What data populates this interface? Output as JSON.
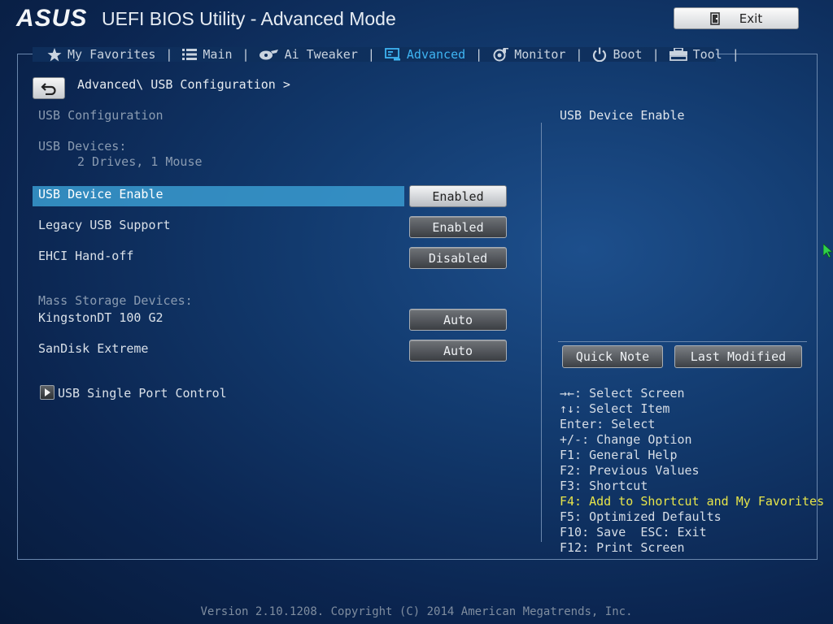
{
  "header": {
    "logo_text": "ASUS",
    "title": "UEFI BIOS Utility - Advanced Mode",
    "exit_label": "Exit"
  },
  "tabs": [
    {
      "label": "My Favorites",
      "icon": "star-icon",
      "active": false
    },
    {
      "label": "Main",
      "icon": "list-icon",
      "active": false
    },
    {
      "label": "Ai Tweaker",
      "icon": "tweaker-icon",
      "active": false
    },
    {
      "label": "Advanced",
      "icon": "advanced-icon",
      "active": true
    },
    {
      "label": "Monitor",
      "icon": "monitor-icon",
      "active": false
    },
    {
      "label": "Boot",
      "icon": "power-icon",
      "active": false
    },
    {
      "label": "Tool",
      "icon": "tool-icon",
      "active": false
    }
  ],
  "breadcrumb": "Advanced\\ USB Configuration >",
  "main": {
    "section_title": "USB Configuration",
    "usb_devices_label": "USB Devices:",
    "usb_devices_value": "2 Drives, 1 Mouse",
    "settings": [
      {
        "label": "USB Device Enable",
        "value": "Enabled",
        "selected": true
      },
      {
        "label": "Legacy USB Support",
        "value": "Enabled",
        "selected": false
      },
      {
        "label": "EHCI Hand-off",
        "value": "Disabled",
        "selected": false
      }
    ],
    "mass_storage_label": "Mass Storage Devices:",
    "mass_storage": [
      {
        "label": "KingstonDT 100 G2",
        "value": "Auto"
      },
      {
        "label": "SanDisk Extreme",
        "value": "Auto"
      }
    ],
    "submenu": "USB Single Port Control"
  },
  "right_panel": {
    "help_title": "USB Device Enable",
    "quick_note": "Quick Note",
    "last_modified": "Last Modified",
    "keys": [
      "→←: Select Screen",
      "↑↓: Select Item",
      "Enter: Select",
      "+/-: Change Option",
      "F1: General Help",
      "F2: Previous Values",
      "F3: Shortcut",
      "F4: Add to Shortcut and My Favorites",
      "F5: Optimized Defaults",
      "F10: Save  ESC: Exit",
      "F12: Print Screen"
    ]
  },
  "footer": "Version 2.10.1208. Copyright (C) 2014 American Megatrends, Inc.",
  "colors": {
    "active_tab": "#3eb4f2",
    "highlight": "#3a9bd0",
    "shortcut_hint": "#e6e44a"
  }
}
